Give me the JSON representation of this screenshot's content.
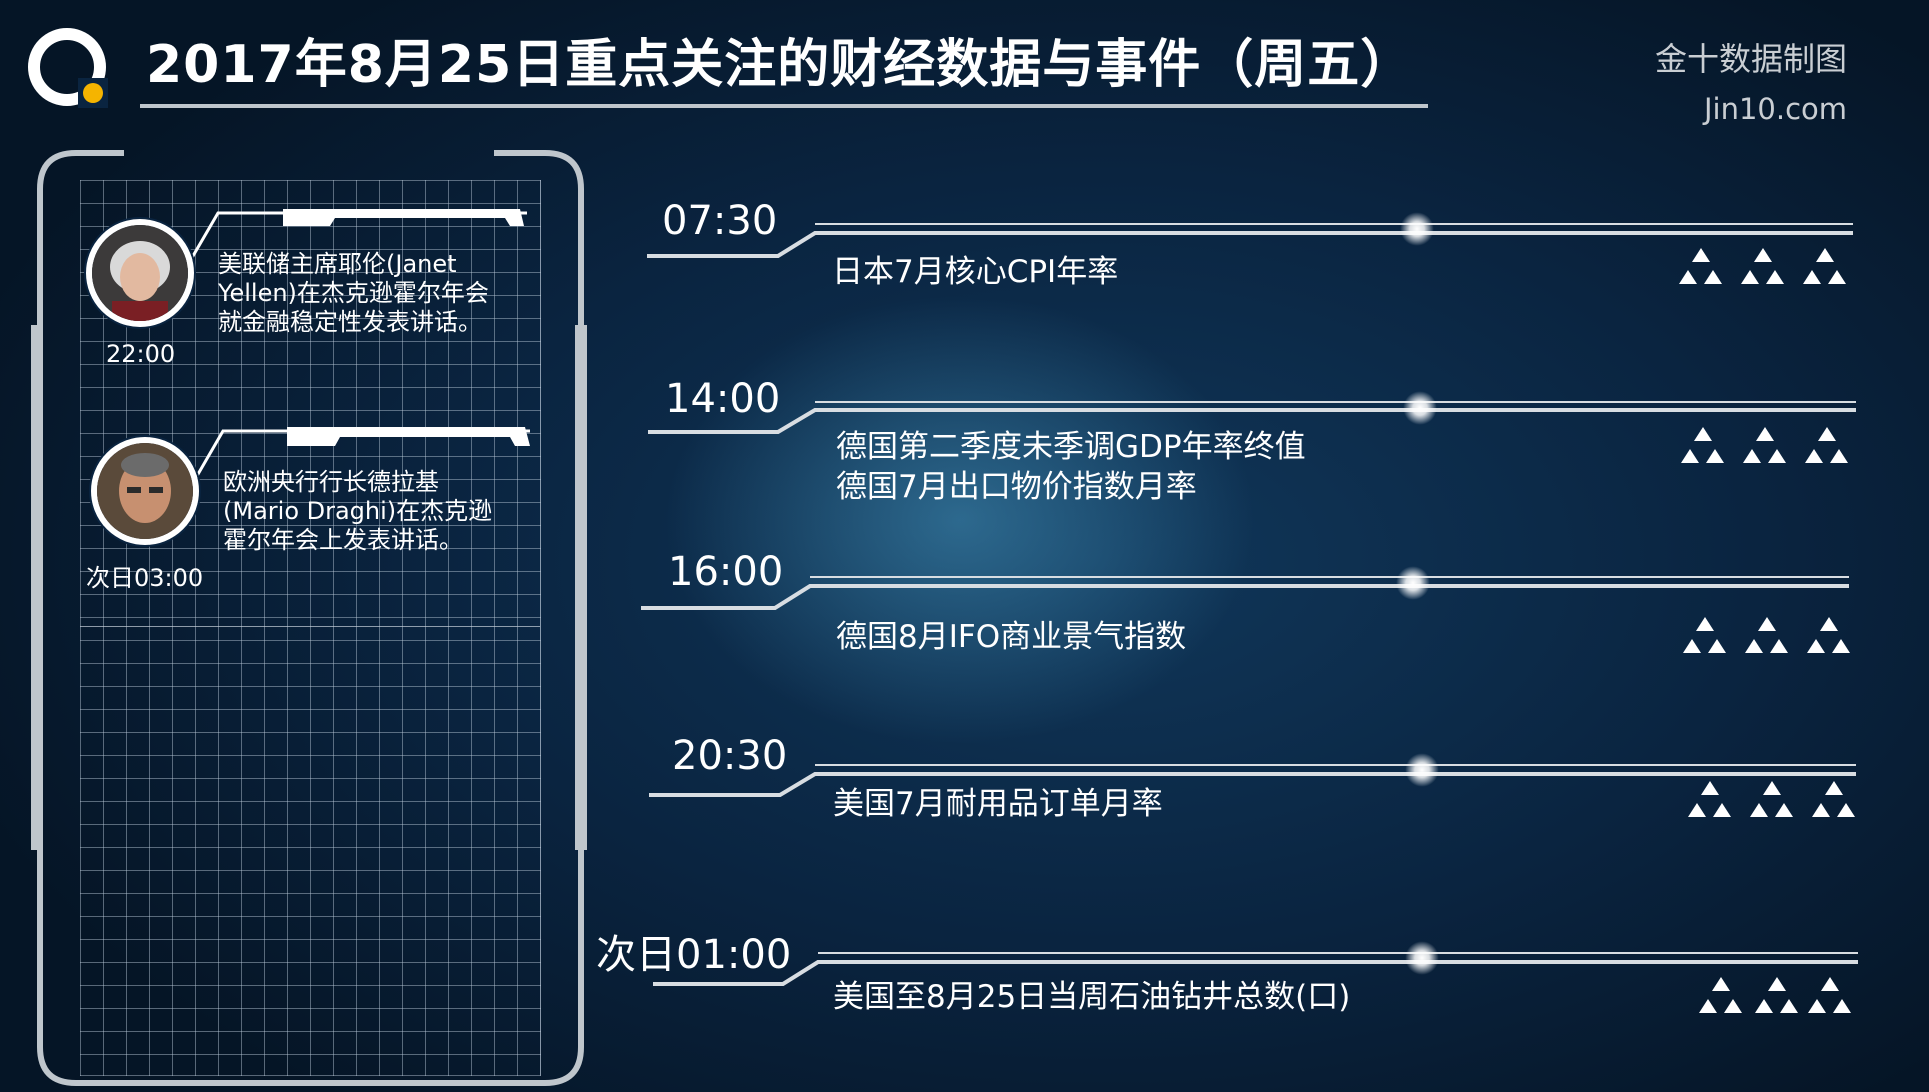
{
  "header": {
    "title": "2017年8月25日重点关注的财经数据与事件（周五）",
    "brand": "金十数据制图",
    "site": "Jin10.com"
  },
  "events": [
    {
      "time": "22:00",
      "description": "美联储主席耶伦(Janet Yellen)在杰克逊霍尔年会就金融稳定性发表讲话。",
      "avatar_icon": "portrait-yellen-icon"
    },
    {
      "time": "次日03:00",
      "description": "欧洲央行行长德拉基(Mario Draghi)在杰克逊霍尔年会上发表讲话。",
      "avatar_icon": "portrait-draghi-icon"
    }
  ],
  "schedule": [
    {
      "time": "07:30",
      "items": [
        "日本7月核心CPI年率"
      ],
      "importance": 6
    },
    {
      "time": "14:00",
      "items": [
        "德国第二季度未季调GDP年率终值",
        "德国7月出口物价指数月率"
      ],
      "importance": 6
    },
    {
      "time": "16:00",
      "items": [
        "德国8月IFO商业景气指数"
      ],
      "importance": 6
    },
    {
      "time": "20:30",
      "items": [
        "美国7月耐用品订单月率"
      ],
      "importance": 6
    },
    {
      "time": "次日01:00",
      "items": [
        "美国至8月25日当周石油钻井总数(口)"
      ],
      "importance": 7
    }
  ],
  "colors": {
    "background": "#0a2440",
    "accent": "#f5b400",
    "line": "#d8dde2"
  }
}
